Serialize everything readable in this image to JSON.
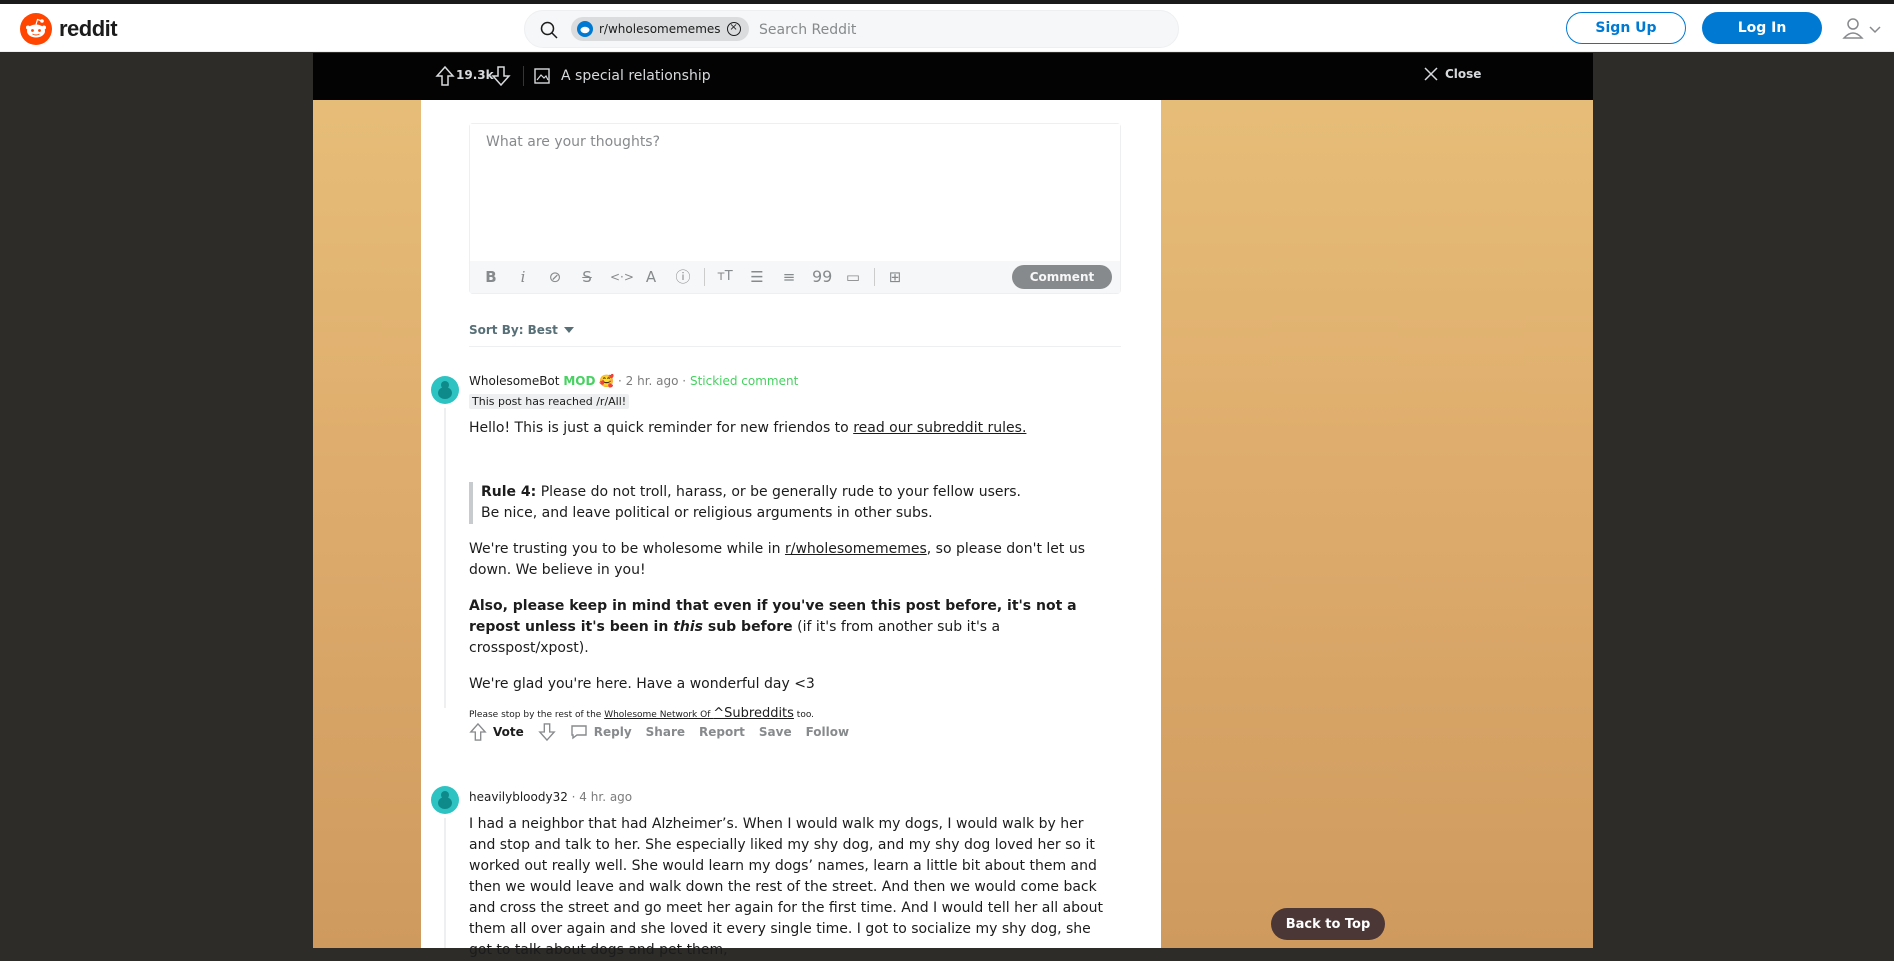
{
  "header": {
    "logo_text": "reddit",
    "search_chip": "r/wholesomememes",
    "search_placeholder": "Search Reddit",
    "signup_label": "Sign Up",
    "login_label": "Log In"
  },
  "post_bar": {
    "votes": "19.3k",
    "title": "A special relationship",
    "close_label": "Close"
  },
  "editor": {
    "placeholder": "What are your thoughts?",
    "comment_label": "Comment",
    "toolbar_icons": [
      "bold-icon",
      "italic-icon",
      "link-icon",
      "strikethrough-icon",
      "inline-code-icon",
      "superscript-icon",
      "spoiler-icon",
      "heading-icon",
      "bulleted-list-icon",
      "numbered-list-icon",
      "quote-block-icon",
      "code-block-icon",
      "table-icon"
    ]
  },
  "sort": {
    "label": "Sort By: Best"
  },
  "comments": [
    {
      "author": "WholesomeBot",
      "mod_badge": "MOD",
      "time": "· 2 hr. ago ·",
      "sticky": "Stickied comment",
      "flair": "This post has reached /r/All!",
      "p1_text": "Hello! This is just a quick reminder for new friendos to ",
      "p1_link": "read our subreddit rules.",
      "rule_label": "Rule 4:",
      "rule_text": " Please do not troll, harass, or be generally rude to your fellow users.",
      "rule_text2": "Be nice, and leave political or religious arguments in other subs.",
      "p2_a": "We're trusting you to be wholesome while in ",
      "p2_link": "r/wholesomememes",
      "p2_b": ", so please don't let us down. We believe in you!",
      "p3_bold": "Also, please keep in mind that even if you've seen this post before, it's not a repost unless it's been in ",
      "p3_italic": "this",
      "p3_bold2": " sub before",
      "p3_rest": " (if it's from another sub it's a crosspost/xpost).",
      "p4": "We're glad you're here. Have a wonderful day <3",
      "small_a": "Please stop by the rest of the ",
      "small_link": "Wholesome Network Of ",
      "small_sup": "^Subreddits",
      "small_b": " too.",
      "vote_label": "Vote",
      "reply": "Reply",
      "share": "Share",
      "report": "Report",
      "save": "Save",
      "follow": "Follow"
    },
    {
      "author": "heavilybloody32",
      "time": "· 4 hr. ago",
      "body": "I had a neighbor that had Alzheimer’s. When I would walk my dogs, I would walk by her and stop and talk to her. She especially liked my shy dog, and my shy dog loved her so it worked out really well. She would learn my dogs’ names, learn a little bit about them and then we would leave and walk down the rest of the street. And then we would come back and cross the street and go meet her again for the first time. And I would tell her all about them all over again and she loved it every single time. I got to socialize my shy dog, she got to talk about dogs and pet them,"
    }
  ],
  "back_to_top": "Back to Top",
  "colors": {
    "reddit_orange": "#ff4500",
    "link_blue": "#0079d3",
    "mod_green": "#46d160",
    "back_to_top_bg": "#4c3737"
  }
}
